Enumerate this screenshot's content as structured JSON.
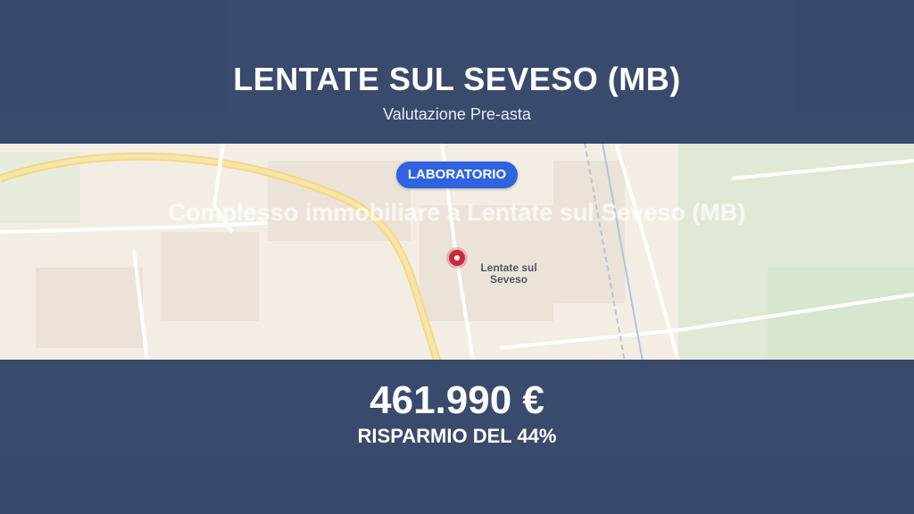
{
  "header": {
    "title": "LENTATE SUL SEVESO (MB)",
    "subtitle": "Valutazione Pre-asta"
  },
  "badge": {
    "label": "LABORATORIO"
  },
  "overlay_title": "Complesso immobiliare a Lentate sul Seveso (MB)",
  "map": {
    "town_label_line1": "Lentate sul",
    "town_label_line2": "Seveso",
    "marker_icon": "map-pin-icon"
  },
  "price": {
    "value": "461.990 €",
    "saving": "RISPARMIO DEL 44%"
  },
  "colors": {
    "band": "#283c62",
    "badge": "#2f63e0",
    "marker": "#c92a3a"
  }
}
